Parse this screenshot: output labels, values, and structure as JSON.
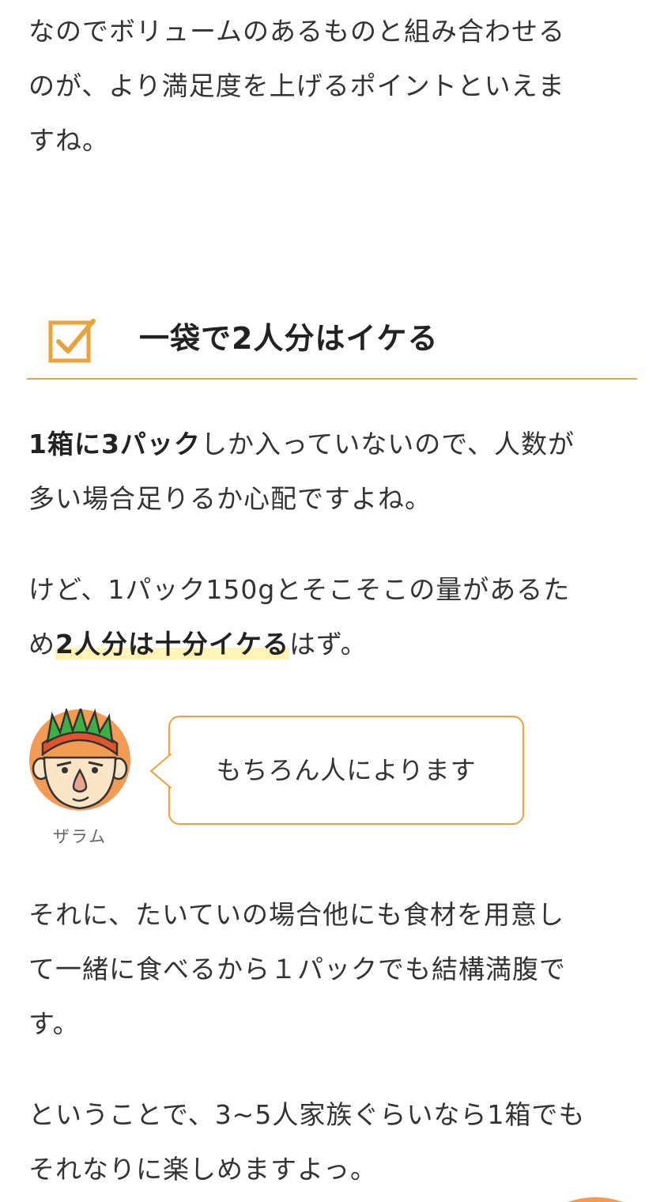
{
  "paragraphs": {
    "p1": {
      "line1": "なのでボリュームのあるものと組み合わせる",
      "line2": "のが、より満足度を上げるポイントといえま",
      "line3": "すね。"
    },
    "p2": {
      "bold": "1箱に3パック",
      "line1_rest": "しか入っていないので、人数が",
      "line2": "多い場合足りるか心配ですよね。"
    },
    "p3": {
      "line1": "けど、1パック150gとそこそこの量があるた",
      "line2_pre": "め",
      "highlight": "2人分は十分イケる",
      "line2_post": "はず。"
    },
    "p4": {
      "line1": "それに、たいていの場合他にも食材を用意し",
      "line2": "て一緒に食べるから１パックでも結構満腹で",
      "line3": "す。"
    },
    "p5": {
      "line1": "ということで、3~5人家族ぐらいなら1箱でも",
      "line2": "それなりに楽しめますよっ。"
    }
  },
  "heading": {
    "title": "一袋で2人分はイケる",
    "icon": "checkbox-icon"
  },
  "speech": {
    "avatar_icon": "character-avatar-icon",
    "name": "ザラム",
    "text": "もちろん人によります"
  },
  "colors": {
    "accent": "#e8a33a",
    "highlight": "#fff4b8",
    "text": "#333333"
  }
}
